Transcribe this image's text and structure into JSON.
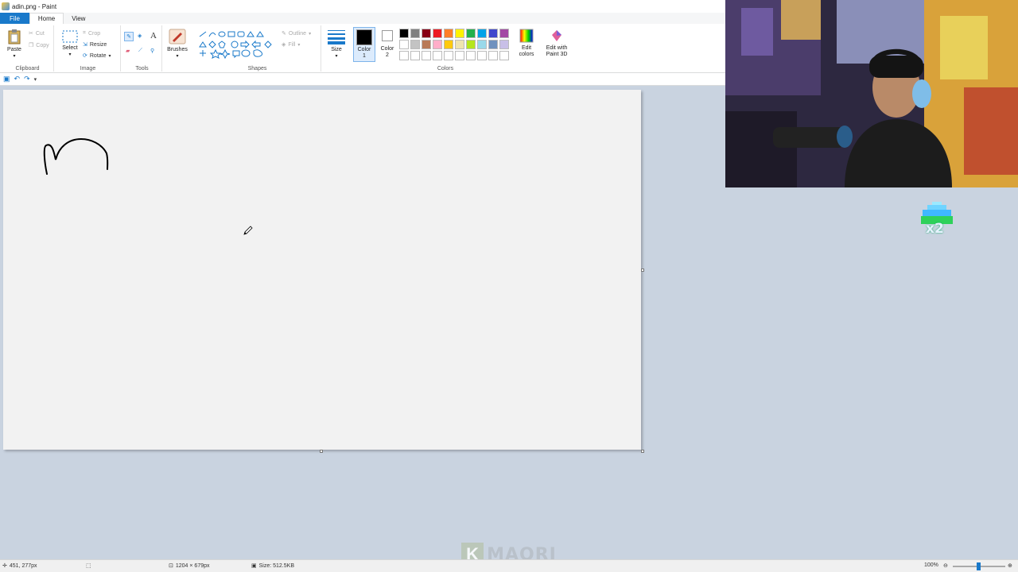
{
  "window": {
    "title": "adin.png - Paint"
  },
  "tabs": [
    {
      "label": "File"
    },
    {
      "label": "Home"
    },
    {
      "label": "View"
    }
  ],
  "ribbon": {
    "clipboard": {
      "label": "Clipboard",
      "paste": "Paste",
      "cut": "Cut",
      "copy": "Copy"
    },
    "image": {
      "label": "Image",
      "select": "Select",
      "crop": "Crop",
      "resize": "Resize",
      "rotate": "Rotate"
    },
    "tools": {
      "label": "Tools"
    },
    "brushes": {
      "label": "Brushes"
    },
    "shapes": {
      "label": "Shapes",
      "outline": "Outline",
      "fill": "Fill"
    },
    "size": {
      "label": "Size"
    },
    "color1": {
      "label": "Color",
      "sub": "1"
    },
    "color2": {
      "label": "Color",
      "sub": "2"
    },
    "colors": {
      "label": "Colors",
      "row1": [
        "#000000",
        "#7f7f7f",
        "#880015",
        "#ed1c24",
        "#ff7f27",
        "#fff200",
        "#22b14c",
        "#00a2e8",
        "#3f48cc",
        "#a349a4"
      ],
      "row2": [
        "#ffffff",
        "#c3c3c3",
        "#b97a57",
        "#ffaec9",
        "#ffc90e",
        "#efe4b0",
        "#b5e61d",
        "#99d9ea",
        "#7092be",
        "#c8bfe7"
      ]
    },
    "edit_colors": {
      "line1": "Edit",
      "line2": "colors"
    },
    "paint3d": {
      "line1": "Edit with",
      "line2": "Paint 3D"
    }
  },
  "statusbar": {
    "cursor_position": "451, 277px",
    "image_dimensions": "1204 × 679px",
    "file_size": "Size: 512.5KB",
    "zoom": "100%"
  },
  "overlay": {
    "watermark_letter": "K",
    "watermark_text": "MAORI",
    "multiplier": "x2"
  },
  "colors": {
    "accent": "#1979ca",
    "workspace": "#c9d3e0",
    "canvas": "#f2f2f2"
  }
}
